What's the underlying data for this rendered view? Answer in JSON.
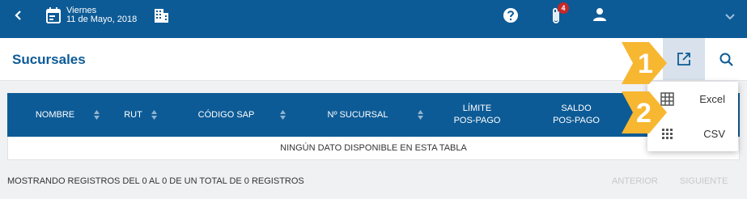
{
  "topbar": {
    "day": "Viernes",
    "date": "11 de Mayo, 2018",
    "notification_count": "4"
  },
  "page": {
    "title": "Sucursales"
  },
  "table": {
    "columns": [
      "NOMBRE",
      "RUT",
      "CÓDIGO SAP",
      "Nº SUCURSAL",
      "LÍMITE\nPOS-PAGO",
      "SALDO\nPOS-PAGO"
    ],
    "empty_message": "NINGÚN DATO DISPONIBLE EN ESTA TABLA"
  },
  "footer": {
    "info": "MOSTRANDO REGISTROS DEL 0 AL 0 DE UN TOTAL DE 0 REGISTROS",
    "prev_label": "ANTERIOR",
    "next_label": "SIGUIENTE"
  },
  "export_menu": {
    "items": [
      {
        "label": "Excel",
        "icon": "table-grid-icon"
      },
      {
        "label": "CSV",
        "icon": "dots-grid-icon"
      }
    ]
  },
  "callouts": [
    "1",
    "2"
  ],
  "colors": {
    "primary": "#0d5b96",
    "callout": "#f7b731",
    "badge": "#c62828"
  }
}
